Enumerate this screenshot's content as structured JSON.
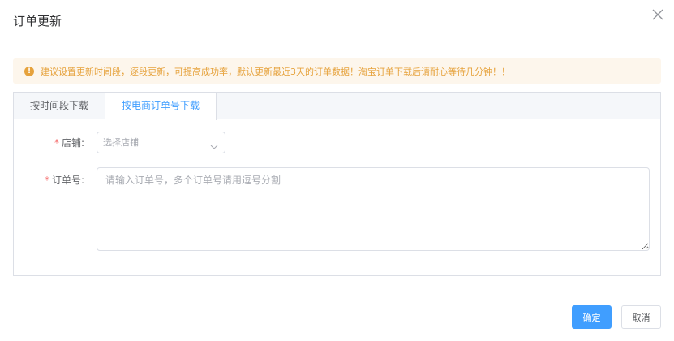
{
  "dialog": {
    "title": "订单更新",
    "close_icon": "close-icon"
  },
  "alert": {
    "icon": "warning-icon",
    "icon_glyph": "!",
    "text": "建议设置更新时间段，逐段更新，可提高成功率，默认更新最近3天的订单数据！淘宝订单下载后请耐心等待几分钟！！",
    "color": "#e6a23c",
    "background": "#fdf6ec"
  },
  "tabs": [
    {
      "label": "按时间段下载",
      "active": false
    },
    {
      "label": "按电商订单号下载",
      "active": true
    }
  ],
  "form": {
    "shop": {
      "required_mark": "*",
      "label": "店铺:",
      "placeholder": "选择店铺",
      "arrow_icon": "chevron-down-icon"
    },
    "order_no": {
      "required_mark": "*",
      "label": "订单号:",
      "placeholder": "请输入订单号，多个订单号请用逗号分割",
      "value": ""
    }
  },
  "footer": {
    "confirm_label": "确定",
    "cancel_label": "取消"
  },
  "colors": {
    "primary": "#409eff",
    "required": "#f56c6c",
    "border": "#dcdfe6"
  }
}
